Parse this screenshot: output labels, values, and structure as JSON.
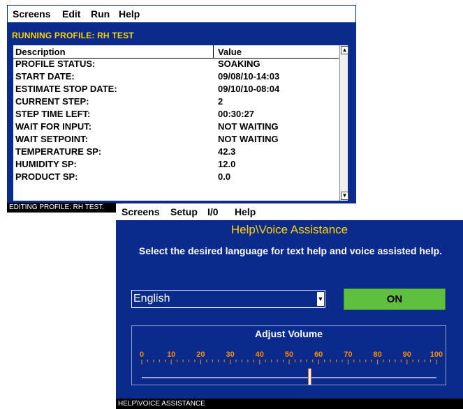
{
  "profile_window": {
    "menu": [
      "Screens",
      "Edit",
      "Run",
      "Help"
    ],
    "title": "RUNNING PROFILE: RH TEST",
    "table": {
      "columns": [
        "Description",
        "Value"
      ],
      "rows": [
        [
          "PROFILE STATUS:",
          "SOAKING"
        ],
        [
          "START DATE:",
          "09/08/10-14:03"
        ],
        [
          "ESTIMATE STOP DATE:",
          "09/10/10-08:04"
        ],
        [
          "CURRENT STEP:",
          "2"
        ],
        [
          "STEP TIME LEFT:",
          "00:30:27"
        ],
        [
          "WAIT FOR INPUT:",
          "NOT WAITING"
        ],
        [
          "WAIT SETPOINT:",
          "NOT WAITING"
        ],
        [
          "TEMPERATURE SP:",
          "42.3"
        ],
        [
          "HUMIDITY SP:",
          "12.0"
        ],
        [
          "PRODUCT SP:",
          "0.0"
        ]
      ]
    },
    "status_text": "EDITING PROFILE: RH TEST."
  },
  "help_window": {
    "menu": [
      "Screens",
      "Setup",
      "I/0",
      "Help"
    ],
    "title": "Help\\Voice Assistance",
    "instruction": "Select the desired language for text help and voice assisted help.",
    "language": {
      "selected": "English"
    },
    "voice_toggle_label": "ON",
    "volume": {
      "label": "Adjust Volume",
      "tick_labels": [
        "0",
        "10",
        "20",
        "30",
        "40",
        "50",
        "60",
        "70",
        "80",
        "90",
        "100"
      ],
      "value": 57
    },
    "status_text": "HELP\\VOICE ASSISTANCE"
  },
  "colors": {
    "panel_blue": "#0a2a8c",
    "title_yellow": "#ffd400",
    "on_green": "#5fbf3f",
    "tick_orange": "#ff8c00"
  }
}
